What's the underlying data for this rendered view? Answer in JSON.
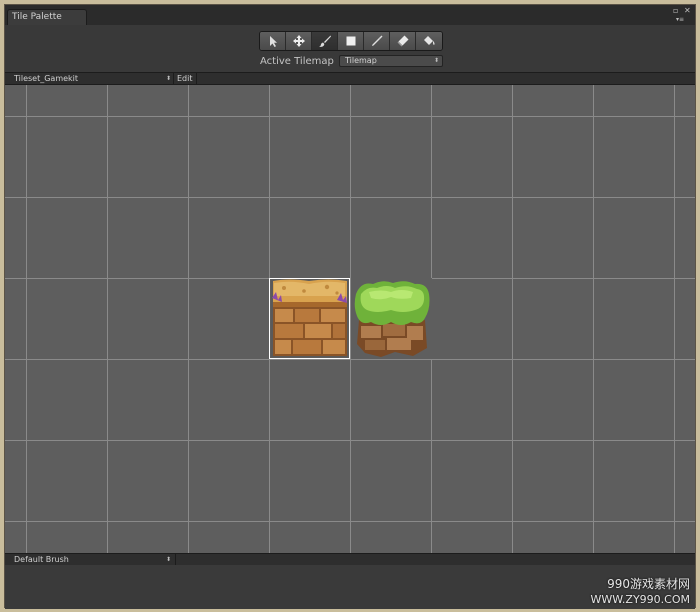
{
  "window": {
    "tab_label": "Tile Palette",
    "controls": [
      "maximize-icon",
      "close-icon",
      "menu-icon"
    ]
  },
  "toolbar": {
    "tools": [
      {
        "name": "select",
        "icon": "arrow-cursor-icon",
        "active": false
      },
      {
        "name": "move",
        "icon": "move-arrows-icon",
        "active": false
      },
      {
        "name": "paint",
        "icon": "brush-icon",
        "active": true
      },
      {
        "name": "box-fill",
        "icon": "square-icon",
        "active": false
      },
      {
        "name": "picker",
        "icon": "eyedropper-icon",
        "active": false
      },
      {
        "name": "erase",
        "icon": "eraser-icon",
        "active": false
      },
      {
        "name": "flood-fill",
        "icon": "paint-bucket-icon",
        "active": false
      }
    ],
    "active_tilemap_label": "Active Tilemap",
    "active_tilemap_value": "Tilemap"
  },
  "palette": {
    "name": "Tileset_Gamekit",
    "edit_label": "Edit"
  },
  "tiles": [
    {
      "name": "dirt-rock-tile",
      "selected": true
    },
    {
      "name": "grass-rock-tile",
      "selected": false
    }
  ],
  "brush": {
    "name": "Default Brush"
  },
  "watermark": {
    "line1": "990游戏素材网",
    "line2": "WWW.ZY990.COM"
  },
  "colors": {
    "panel_bg": "#393939",
    "grid_bg": "#5e5e5e",
    "grid_line": "#8a8a8a",
    "outer_frame": "#c9bd9c",
    "selection": "#ffffff"
  }
}
